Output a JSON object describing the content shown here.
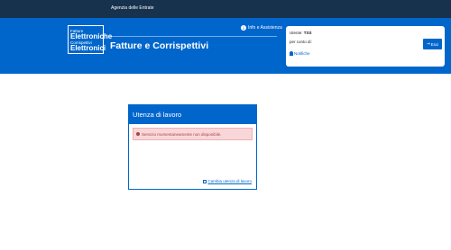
{
  "topbar": {
    "brand": "Agenzia delle Entrate"
  },
  "header": {
    "logo": {
      "line1a": "Fatture",
      "line1b": "Elettroniche",
      "line2a": "Corrispettivi",
      "line2b": "Elettronici"
    },
    "info_label": "Info e Assistenza",
    "title": "Fatture e Corrispettivi"
  },
  "user": {
    "prefix": "Utente:",
    "name": "TSS",
    "on_behalf": "per conto di:",
    "notifications": "Notifiche",
    "exit": "Esci"
  },
  "card": {
    "title": "Utenza di lavoro",
    "alert": "Servizio momentaneamente non disponibile.",
    "change_link": "Cambia utenza di lavoro"
  }
}
